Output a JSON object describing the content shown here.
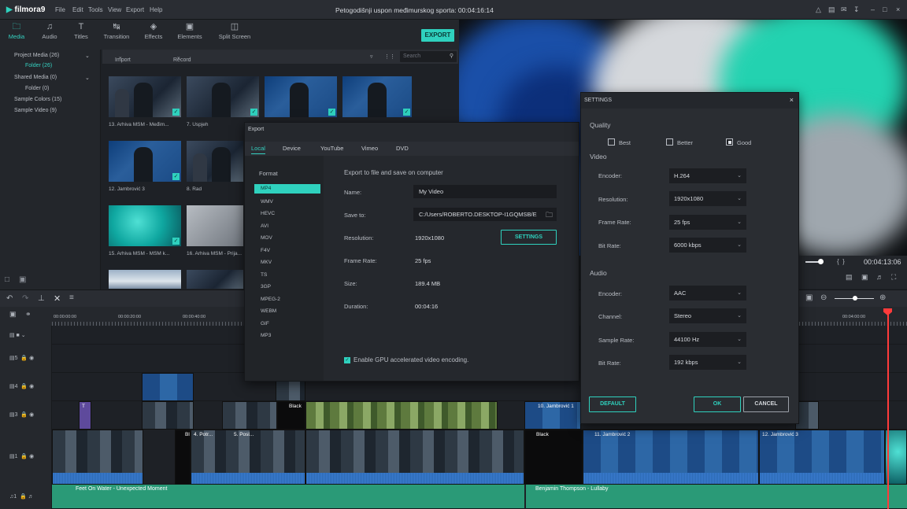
{
  "app": {
    "logo": "filmora9",
    "menu": [
      "File",
      "Edit",
      "Tools",
      "View",
      "Export",
      "Help"
    ],
    "title": "Petogodišnji uspon međimurskog sporta:  00:04:16:14",
    "window_controls": [
      "–",
      "□",
      "×"
    ]
  },
  "tabs": [
    {
      "label": "Media",
      "icon": "🗀"
    },
    {
      "label": "Audio",
      "icon": "♫"
    },
    {
      "label": "Titles",
      "icon": "T"
    },
    {
      "label": "Transition",
      "icon": "⤳"
    },
    {
      "label": "Effects",
      "icon": "◈"
    },
    {
      "label": "Elements",
      "icon": "▣"
    },
    {
      "label": "Split Screen",
      "icon": "◫"
    }
  ],
  "export_button": "EXPORT",
  "sidebar": {
    "items": [
      {
        "label": "Project Media (26)"
      },
      {
        "label": "Folder (26)"
      },
      {
        "label": "Shared Media (0)"
      },
      {
        "label": "Folder (0)"
      },
      {
        "label": "Sample Colors (15)"
      },
      {
        "label": "Sample Video (9)"
      }
    ]
  },
  "media_bar": {
    "import": "Import",
    "record": "Record",
    "search_placeholder": "Search"
  },
  "thumbnails": [
    {
      "label": "13. Arhiva MSM - Međim..."
    },
    {
      "label": "7. Uspjeh"
    },
    {
      "label": ""
    },
    {
      "label": ""
    },
    {
      "label": "12. Jambrović 3"
    },
    {
      "label": "8. Rad"
    },
    {
      "label": "15. Arhiva MSM - MSM k..."
    },
    {
      "label": "16. Arhiva MSM - Prija..."
    }
  ],
  "preview": {
    "timecode": "00:04:13:06"
  },
  "timeline": {
    "ruler": [
      "00:00:00:00",
      "00:00:20:00",
      "00:00:40:00",
      "00:04:00:00"
    ],
    "tracks": [
      "5",
      "4",
      "3",
      "2",
      "1"
    ],
    "audio_track": "1",
    "clips": {
      "black_1": "Black",
      "black_2": "Black",
      "jambrovic_2": "11. Jambrović 2",
      "jambrovic_3": "12. Jambrović 3",
      "potres": "4. Potr...",
      "posao": "5. Posl...",
      "jambrovic1": "10. Jambrović 1"
    },
    "audio_clips": [
      "Feet On Water - Unexpected Moment",
      "Benjamin Thompson - Lullaby"
    ]
  },
  "export_dialog": {
    "title": "Export",
    "tabs": [
      "Local",
      "Device",
      "YouTube",
      "Vimeo",
      "DVD"
    ],
    "format_header": "Format",
    "formats": [
      "MP4",
      "WMV",
      "HEVC",
      "AVI",
      "MOV",
      "F4V",
      "MKV",
      "TS",
      "3GP",
      "MPEG-2",
      "WEBM",
      "GIF",
      "MP3"
    ],
    "heading": "Export to file and save on computer",
    "name_label": "Name:",
    "name_value": "My Video",
    "save_label": "Save to:",
    "save_value": "C:/Users/ROBERTO.DESKTOP-I1GQMSB/E",
    "resolution_label": "Resolution:",
    "resolution_value": "1920x1080",
    "settings_button": "SETTINGS",
    "framerate_label": "Frame Rate:",
    "framerate_value": "25 fps",
    "size_label": "Size:",
    "size_value": "189.4 MB",
    "duration_label": "Duration:",
    "duration_value": "00:04:16",
    "gpu_label": "Enable GPU accelerated video encoding."
  },
  "settings_dialog": {
    "title": "SETTINGS",
    "quality_label": "Quality",
    "quality_options": [
      "Best",
      "Better",
      "Good"
    ],
    "quality_selected": "Good",
    "video_label": "Video",
    "video": [
      {
        "label": "Encoder:",
        "value": "H.264"
      },
      {
        "label": "Resolution:",
        "value": "1920x1080"
      },
      {
        "label": "Frame Rate:",
        "value": "25 fps"
      },
      {
        "label": "Bit Rate:",
        "value": "6000 kbps"
      }
    ],
    "audio_label": "Audio",
    "audio": [
      {
        "label": "Encoder:",
        "value": "AAC"
      },
      {
        "label": "Channel:",
        "value": "Stereo"
      },
      {
        "label": "Sample Rate:",
        "value": "44100 Hz"
      },
      {
        "label": "Bit Rate:",
        "value": "192 kbps"
      }
    ],
    "default_button": "DEFAULT",
    "ok_button": "OK",
    "cancel_button": "CANCEL"
  },
  "colors": {
    "accent": "#2fd1be",
    "playhead": "#ff3b3b"
  }
}
